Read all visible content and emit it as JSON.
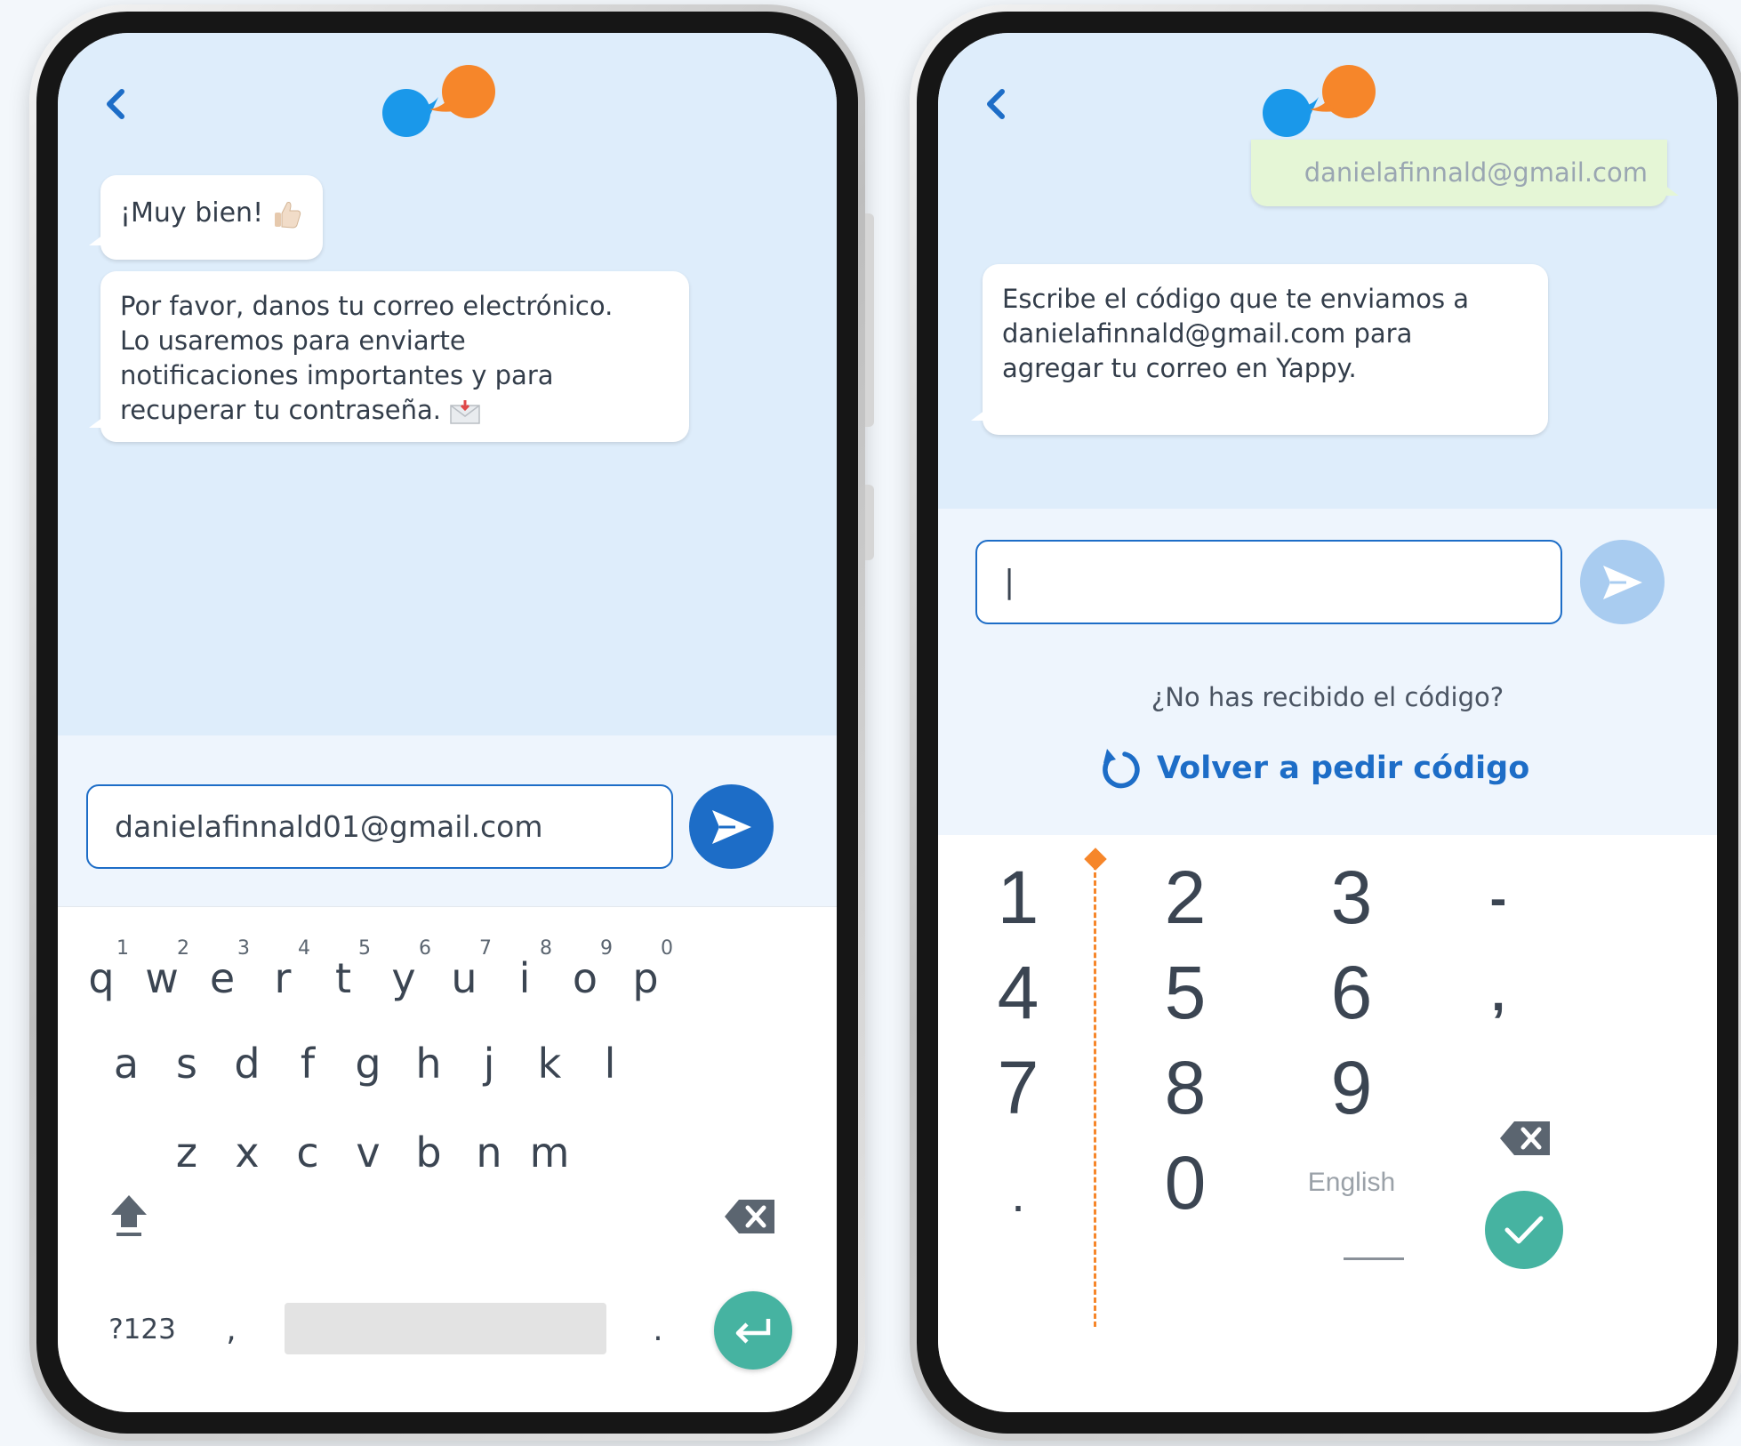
{
  "colors": {
    "chat_bg": "#deedfb",
    "input_bg": "#eef5fd",
    "primary_blue": "#1d6dc7",
    "send_disabled": "#a9ccf0",
    "teal": "#46b3a1",
    "user_bubble": "#e5f6d6",
    "logo_blue": "#1a98ea",
    "logo_orange": "#f6862a",
    "guide_orange": "#f6862a"
  },
  "left_screen": {
    "back_icon": "chevron-left-icon",
    "logo_icon": "chat-bubbles-logo-icon",
    "messages": [
      {
        "text": "¡Muy bien! ",
        "emoji": "thumbs-up-icon"
      },
      {
        "lines": [
          "Por favor, danos tu correo electrónico.",
          "Lo usaremos para enviarte",
          "notificaciones importantes y para",
          "recuperar tu contraseña. "
        ],
        "emoji": "envelope-icon"
      }
    ],
    "email_input": {
      "value": "danielafinnald01@gmail.com"
    },
    "send_icon": "send-icon",
    "keyboard": {
      "row1": [
        {
          "key": "q",
          "hint": "1"
        },
        {
          "key": "w",
          "hint": "2"
        },
        {
          "key": "e",
          "hint": "3"
        },
        {
          "key": "r",
          "hint": "4"
        },
        {
          "key": "t",
          "hint": "5"
        },
        {
          "key": "y",
          "hint": "6"
        },
        {
          "key": "u",
          "hint": "7"
        },
        {
          "key": "i",
          "hint": "8"
        },
        {
          "key": "o",
          "hint": "9"
        },
        {
          "key": "p",
          "hint": "0"
        }
      ],
      "row2": [
        "a",
        "s",
        "d",
        "f",
        "g",
        "h",
        "j",
        "k",
        "l"
      ],
      "row3": [
        "z",
        "x",
        "c",
        "v",
        "b",
        "n",
        "m"
      ],
      "shift_icon": "shift-icon",
      "backspace_icon": "backspace-icon",
      "symbols_label": "?123",
      "comma": ",",
      "period": ".",
      "enter_icon": "enter-icon"
    }
  },
  "right_screen": {
    "back_icon": "chevron-left-icon",
    "logo_icon": "chat-bubbles-logo-icon",
    "user_message": "danielafinnald@gmail.com",
    "bot_message_lines": [
      "Escribe el código que te enviamos a",
      "danielafinnald@gmail.com para",
      "agregar tu correo en Yappy."
    ],
    "code_input": {
      "value": "|"
    },
    "send_icon": "send-icon",
    "not_received": "¿No has recibido el código?",
    "resend_label": "Volver a pedir código",
    "resend_icon": "refresh-icon",
    "numpad": {
      "rows": [
        [
          "1",
          "2",
          "3",
          "-"
        ],
        [
          "4",
          "5",
          "6",
          ","
        ],
        [
          "7",
          "8",
          "9",
          ""
        ],
        [
          ".",
          "0",
          "English",
          ""
        ]
      ],
      "backspace_icon": "backspace-icon",
      "done_icon": "check-icon"
    }
  }
}
